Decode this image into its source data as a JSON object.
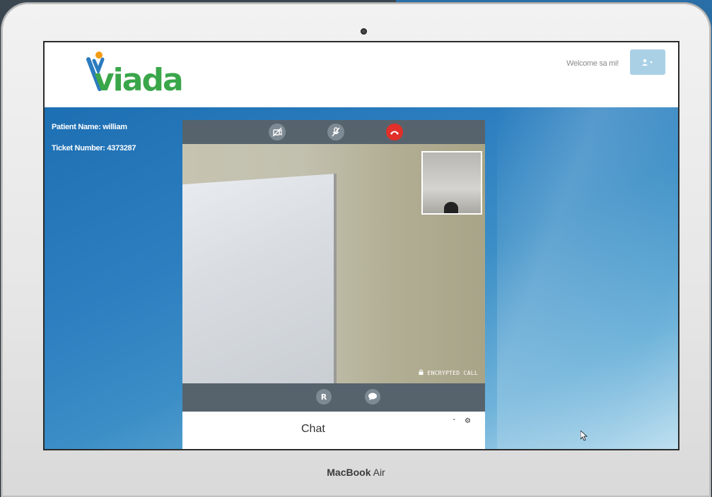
{
  "app": {
    "logo_text": "viada",
    "welcome_text": "Welcome sa mi!",
    "user_menu_icon": "user-caret-icon"
  },
  "patient": {
    "name_line": "Patient Name: william",
    "ticket_line": "Ticket Number: 4373287"
  },
  "call_controls": {
    "camera_icon": "camera-off-icon",
    "mic_icon": "mic-off-icon",
    "hangup_icon": "hangup-icon"
  },
  "video": {
    "encrypted_label": "ENCRYPTED CALL",
    "lock_icon": "lock-icon"
  },
  "tools": {
    "rx_label": "R",
    "rx_icon": "prescription-icon",
    "chat_icon": "chat-bubble-icon"
  },
  "chat": {
    "label": "Chat",
    "chevron": "ˇ",
    "gear": "⚙"
  },
  "device": {
    "brand": "MacBook",
    "model": "Air"
  },
  "colors": {
    "brand_green": "#3aa64a",
    "brand_orange": "#f39c12",
    "hangup_red": "#e1302a",
    "toolbar_gray": "#56636d",
    "user_button": "#aad0e6",
    "content_blue": "#2d7fc0"
  }
}
